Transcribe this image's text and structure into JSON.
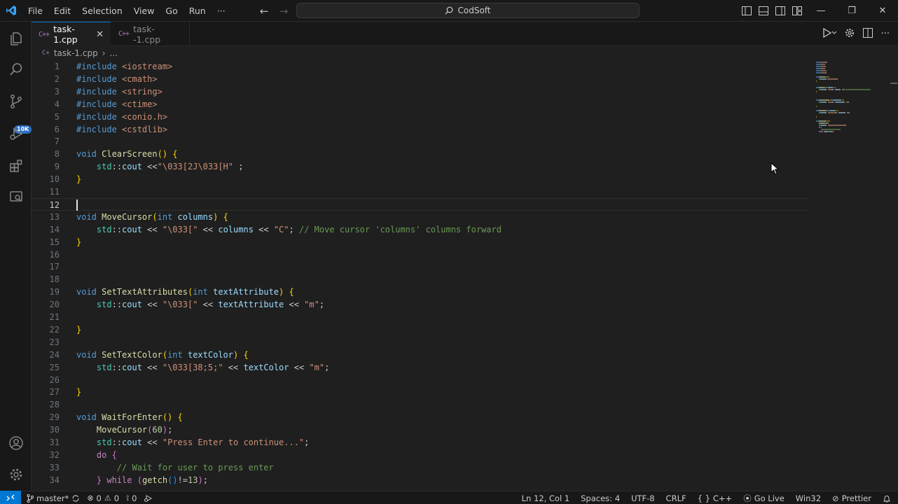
{
  "menu": [
    "File",
    "Edit",
    "Selection",
    "View",
    "Go",
    "Run",
    "···"
  ],
  "search": {
    "label": "CodSoft"
  },
  "window": {
    "minimize": "—",
    "restore": "❐",
    "close": "✕"
  },
  "activity": {
    "scm_badge": "10K"
  },
  "tabs": [
    {
      "label": "task-1.cpp",
      "icon_text": "C++",
      "active": true,
      "close": "✕"
    },
    {
      "label": "task--1.cpp",
      "icon_text": "C++",
      "active": false
    }
  ],
  "breadcrumb": {
    "file": "task-1.cpp",
    "sep": "›",
    "rest": "..."
  },
  "editor": {
    "lines": [
      {
        "n": "1",
        "t": [
          {
            "c": "kw",
            "s": "#include"
          },
          {
            "c": "str",
            "s": " <iostream>"
          }
        ]
      },
      {
        "n": "2",
        "t": [
          {
            "c": "kw",
            "s": "#include"
          },
          {
            "c": "str",
            "s": " <cmath>"
          }
        ]
      },
      {
        "n": "3",
        "t": [
          {
            "c": "kw",
            "s": "#include"
          },
          {
            "c": "str",
            "s": " <string>"
          }
        ]
      },
      {
        "n": "4",
        "t": [
          {
            "c": "kw",
            "s": "#include"
          },
          {
            "c": "str",
            "s": " <ctime>"
          }
        ]
      },
      {
        "n": "5",
        "t": [
          {
            "c": "kw",
            "s": "#include"
          },
          {
            "c": "str",
            "s": " <conio.h>"
          }
        ]
      },
      {
        "n": "6",
        "t": [
          {
            "c": "kw",
            "s": "#include"
          },
          {
            "c": "str",
            "s": " <cstdlib>"
          }
        ]
      },
      {
        "n": "7",
        "t": []
      },
      {
        "n": "8",
        "t": [
          {
            "c": "kw",
            "s": "void"
          },
          {
            "c": "fn",
            "s": " ClearScreen"
          },
          {
            "c": "br",
            "s": "()"
          },
          {
            "c": "pl",
            "s": " "
          },
          {
            "c": "br",
            "s": "{"
          }
        ]
      },
      {
        "n": "9",
        "t": [
          {
            "c": "pl",
            "s": "    "
          },
          {
            "c": "ns",
            "s": "std"
          },
          {
            "c": "pl",
            "s": "::"
          },
          {
            "c": "var",
            "s": "cout"
          },
          {
            "c": "pl",
            "s": " <<"
          },
          {
            "c": "str",
            "s": "\"\\033[2J\\033[H\""
          },
          {
            "c": "pl",
            "s": " ;"
          }
        ]
      },
      {
        "n": "10",
        "t": [
          {
            "c": "br",
            "s": "}"
          }
        ]
      },
      {
        "n": "11",
        "t": []
      },
      {
        "n": "12",
        "t": [],
        "current": true
      },
      {
        "n": "13",
        "t": [
          {
            "c": "kw",
            "s": "void"
          },
          {
            "c": "fn",
            "s": " MoveCursor"
          },
          {
            "c": "br",
            "s": "("
          },
          {
            "c": "kw",
            "s": "int"
          },
          {
            "c": "var",
            "s": " columns"
          },
          {
            "c": "br",
            "s": ")"
          },
          {
            "c": "pl",
            "s": " "
          },
          {
            "c": "br",
            "s": "{"
          }
        ]
      },
      {
        "n": "14",
        "t": [
          {
            "c": "pl",
            "s": "    "
          },
          {
            "c": "ns",
            "s": "std"
          },
          {
            "c": "pl",
            "s": "::"
          },
          {
            "c": "var",
            "s": "cout"
          },
          {
            "c": "pl",
            "s": " << "
          },
          {
            "c": "str",
            "s": "\"\\033[\""
          },
          {
            "c": "pl",
            "s": " << "
          },
          {
            "c": "var",
            "s": "columns"
          },
          {
            "c": "pl",
            "s": " << "
          },
          {
            "c": "str",
            "s": "\"C\""
          },
          {
            "c": "pl",
            "s": "; "
          },
          {
            "c": "cm",
            "s": "// Move cursor 'columns' columns forward"
          }
        ]
      },
      {
        "n": "15",
        "t": [
          {
            "c": "br",
            "s": "}"
          }
        ]
      },
      {
        "n": "16",
        "t": []
      },
      {
        "n": "17",
        "t": []
      },
      {
        "n": "18",
        "t": []
      },
      {
        "n": "19",
        "t": [
          {
            "c": "kw",
            "s": "void"
          },
          {
            "c": "fn",
            "s": " SetTextAttributes"
          },
          {
            "c": "br",
            "s": "("
          },
          {
            "c": "kw",
            "s": "int"
          },
          {
            "c": "var",
            "s": " textAttribute"
          },
          {
            "c": "br",
            "s": ")"
          },
          {
            "c": "pl",
            "s": " "
          },
          {
            "c": "br",
            "s": "{"
          }
        ]
      },
      {
        "n": "20",
        "t": [
          {
            "c": "pl",
            "s": "    "
          },
          {
            "c": "ns",
            "s": "std"
          },
          {
            "c": "pl",
            "s": "::"
          },
          {
            "c": "var",
            "s": "cout"
          },
          {
            "c": "pl",
            "s": " << "
          },
          {
            "c": "str",
            "s": "\"\\033[\""
          },
          {
            "c": "pl",
            "s": " << "
          },
          {
            "c": "var",
            "s": "textAttribute"
          },
          {
            "c": "pl",
            "s": " << "
          },
          {
            "c": "str",
            "s": "\"m\""
          },
          {
            "c": "pl",
            "s": ";"
          }
        ]
      },
      {
        "n": "21",
        "t": []
      },
      {
        "n": "22",
        "t": [
          {
            "c": "br",
            "s": "}"
          }
        ]
      },
      {
        "n": "23",
        "t": []
      },
      {
        "n": "24",
        "t": [
          {
            "c": "kw",
            "s": "void"
          },
          {
            "c": "fn",
            "s": " SetTextColor"
          },
          {
            "c": "br",
            "s": "("
          },
          {
            "c": "kw",
            "s": "int"
          },
          {
            "c": "var",
            "s": " textColor"
          },
          {
            "c": "br",
            "s": ")"
          },
          {
            "c": "pl",
            "s": " "
          },
          {
            "c": "br",
            "s": "{"
          }
        ]
      },
      {
        "n": "25",
        "t": [
          {
            "c": "pl",
            "s": "    "
          },
          {
            "c": "ns",
            "s": "std"
          },
          {
            "c": "pl",
            "s": "::"
          },
          {
            "c": "var",
            "s": "cout"
          },
          {
            "c": "pl",
            "s": " << "
          },
          {
            "c": "str",
            "s": "\"\\033[38;5;\""
          },
          {
            "c": "pl",
            "s": " << "
          },
          {
            "c": "var",
            "s": "textColor"
          },
          {
            "c": "pl",
            "s": " << "
          },
          {
            "c": "str",
            "s": "\"m\""
          },
          {
            "c": "pl",
            "s": ";"
          }
        ]
      },
      {
        "n": "26",
        "t": []
      },
      {
        "n": "27",
        "t": [
          {
            "c": "br",
            "s": "}"
          }
        ]
      },
      {
        "n": "28",
        "t": []
      },
      {
        "n": "29",
        "t": [
          {
            "c": "kw",
            "s": "void"
          },
          {
            "c": "fn",
            "s": " WaitForEnter"
          },
          {
            "c": "br",
            "s": "()"
          },
          {
            "c": "pl",
            "s": " "
          },
          {
            "c": "br",
            "s": "{"
          }
        ]
      },
      {
        "n": "30",
        "t": [
          {
            "c": "pl",
            "s": "    "
          },
          {
            "c": "fn",
            "s": "MoveCursor"
          },
          {
            "c": "br2",
            "s": "("
          },
          {
            "c": "num",
            "s": "60"
          },
          {
            "c": "br2",
            "s": ")"
          },
          {
            "c": "pl",
            "s": ";"
          }
        ]
      },
      {
        "n": "31",
        "t": [
          {
            "c": "pl",
            "s": "    "
          },
          {
            "c": "ns",
            "s": "std"
          },
          {
            "c": "pl",
            "s": "::"
          },
          {
            "c": "var",
            "s": "cout"
          },
          {
            "c": "pl",
            "s": " << "
          },
          {
            "c": "str",
            "s": "\"Press Enter to continue...\""
          },
          {
            "c": "pl",
            "s": ";"
          }
        ]
      },
      {
        "n": "32",
        "t": [
          {
            "c": "pl",
            "s": "    "
          },
          {
            "c": "kw2",
            "s": "do"
          },
          {
            "c": "pl",
            "s": " "
          },
          {
            "c": "br2",
            "s": "{"
          }
        ]
      },
      {
        "n": "33",
        "t": [
          {
            "c": "pl",
            "s": "        "
          },
          {
            "c": "cm",
            "s": "// Wait for user to press enter"
          }
        ]
      },
      {
        "n": "34",
        "t": [
          {
            "c": "pl",
            "s": "    "
          },
          {
            "c": "br2",
            "s": "}"
          },
          {
            "c": "kw2",
            "s": " while"
          },
          {
            "c": "pl",
            "s": " "
          },
          {
            "c": "br2",
            "s": "("
          },
          {
            "c": "fn",
            "s": "getch"
          },
          {
            "c": "br3",
            "s": "()"
          },
          {
            "c": "pl",
            "s": "!="
          },
          {
            "c": "num",
            "s": "13"
          },
          {
            "c": "br2",
            "s": ")"
          },
          {
            "c": "pl",
            "s": ";"
          }
        ]
      }
    ]
  },
  "statusbar": {
    "remote": "⟩<",
    "branch": "master*",
    "errors": "0",
    "warnings": "0",
    "ports": "0",
    "position": "Ln 12, Col 1",
    "spaces": "Spaces: 4",
    "encoding": "UTF-8",
    "eol": "CRLF",
    "braces": "{ }",
    "language": "C++",
    "golive": "Go Live",
    "platform": "Win32",
    "prettier": "Prettier"
  },
  "colors": {
    "kw": "#569cd6",
    "kw2": "#c586c0",
    "fn": "#dcdcaa",
    "str": "#ce9178",
    "var": "#9cdcfe",
    "ns": "#4ec9b0",
    "num": "#b5cea8",
    "cm": "#6a9955",
    "br": "#ffd700",
    "br2": "#da70d6",
    "br3": "#179fff",
    "pl": "#cccccc",
    "accent": "#0078d4"
  }
}
